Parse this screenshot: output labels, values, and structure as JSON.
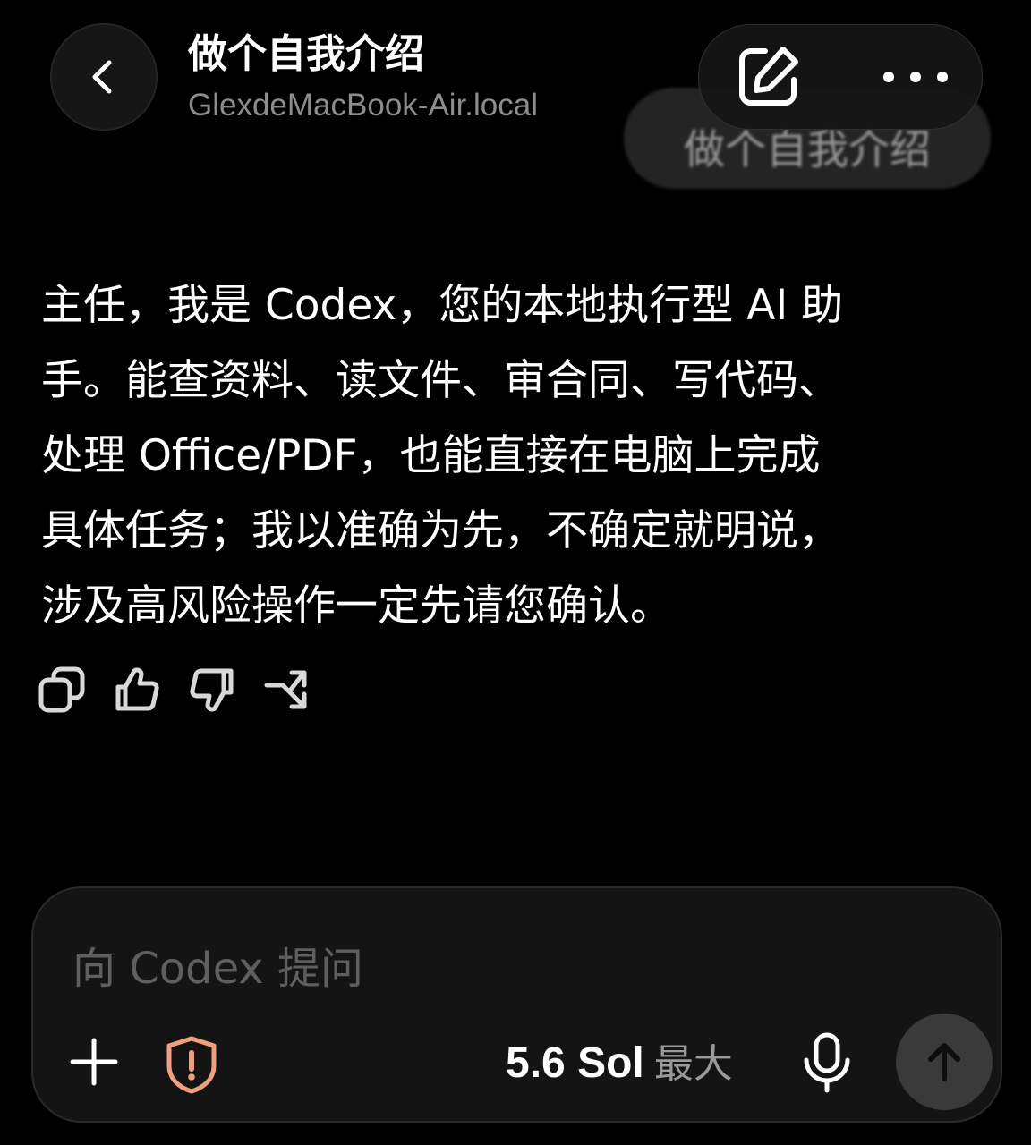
{
  "header": {
    "title": "做个自我介绍",
    "subtitle": "GlexdeMacBook-Air.local"
  },
  "user_message": "做个自我介绍",
  "assistant_message": {
    "lines": [
      "主任，我是 Codex，您的本地执行型 AI 助",
      "手。能查资料、读文件、审合同、写代码、",
      "处理 Office/PDF，也能直接在电脑上完成",
      "具体任务；我以准确为先，不确定就明说，",
      "涉及高风险操作一定先请您确认。"
    ]
  },
  "message_actions": [
    "copy-icon",
    "thumbs-up-icon",
    "thumbs-down-icon",
    "branch-icon"
  ],
  "composer": {
    "placeholder": "向 Codex 提问",
    "model_name": "5.6 Sol",
    "model_level": "最大"
  },
  "colors": {
    "background": "#000000",
    "shield_accent": "#f0a07e",
    "placeholder": "#5f5f5f",
    "send_button": "#3a3a3a"
  }
}
